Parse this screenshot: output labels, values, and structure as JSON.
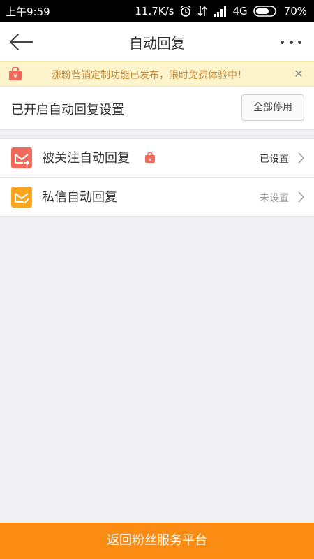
{
  "status_bar": {
    "time": "上午9:59",
    "speed": "11.7K/s",
    "network": "4G",
    "battery": "70%"
  },
  "nav": {
    "title": "自动回复",
    "back_icon": "back-arrow-icon",
    "more_icon": "more-dots-icon"
  },
  "banner": {
    "text": "涨粉营销定制功能已发布，限时免费体验中！",
    "close": "✕"
  },
  "header": {
    "title": "已开启自动回复设置",
    "stop_all_label": "全部停用"
  },
  "items": [
    {
      "label": "被关注自动回复",
      "status": "已设置",
      "icon": "follow-reply-icon",
      "status_color": "#333333"
    },
    {
      "label": "私信自动回复",
      "status": "未设置",
      "icon": "message-reply-icon",
      "status_color": "#999999"
    }
  ],
  "bottom_button": {
    "label": "返回粉丝服务平台"
  },
  "colors": {
    "accent": "#fb8c13",
    "follow_icon_bg": "#ef6a5a",
    "message_icon_bg": "#f9a51d",
    "banner_bg": "#fdf4cc",
    "banner_text": "#c88a3a"
  }
}
